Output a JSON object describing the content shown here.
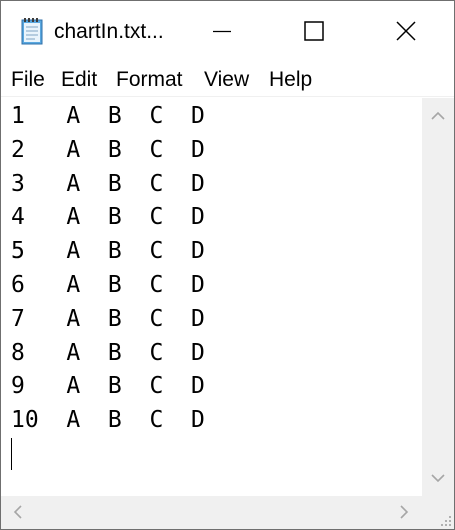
{
  "window": {
    "title": "chartIn.txt...",
    "icons": {
      "app": "notepad-icon",
      "minimize": "minimize-icon",
      "maximize": "maximize-icon",
      "close": "close-icon"
    }
  },
  "menu": {
    "items": [
      "File",
      "Edit",
      "Format",
      "View",
      "Help"
    ]
  },
  "editor": {
    "lines": [
      "1   A  B  C  D",
      "2   A  B  C  D",
      "3   A  B  C  D",
      "4   A  B  C  D",
      "5   A  B  C  D",
      "6   A  B  C  D",
      "7   A  B  C  D",
      "8   A  B  C  D",
      "9   A  B  C  D",
      "10  A  B  C  D"
    ]
  },
  "colors": {
    "titlebar": "#ffffff",
    "scrollbar": "#f0f0f0",
    "text": "#000000",
    "border": "#6f6f6f"
  }
}
